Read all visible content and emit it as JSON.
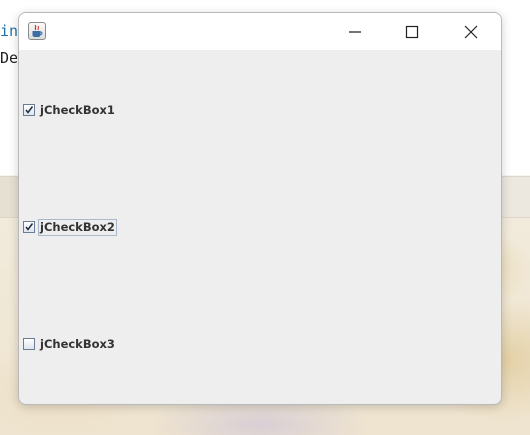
{
  "background_editor": {
    "line1": "in",
    "line2": "Der"
  },
  "window": {
    "title": "",
    "controls": {
      "minimize_icon": "minimize-icon",
      "maximize_icon": "maximize-icon",
      "close_icon": "close-icon"
    }
  },
  "checkboxes": [
    {
      "label": "jCheckBox1",
      "checked": true,
      "focused": false
    },
    {
      "label": "jCheckBox2",
      "checked": true,
      "focused": true
    },
    {
      "label": "jCheckBox3",
      "checked": false,
      "focused": false
    }
  ],
  "colors": {
    "window_bg": "#eeeeee",
    "titlebar_bg": "#ffffff",
    "checkbox_border": "#6b7d94",
    "check_mark": "#1f2d3d",
    "label_text": "#333333"
  }
}
